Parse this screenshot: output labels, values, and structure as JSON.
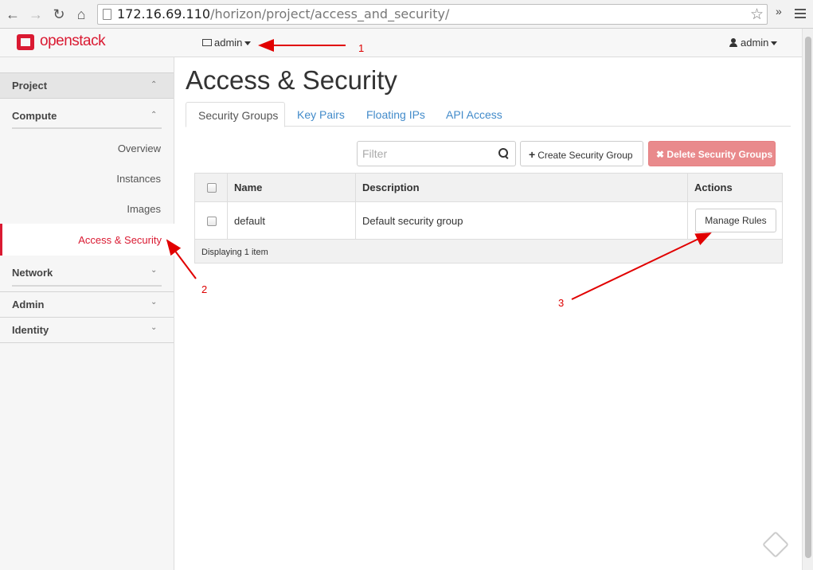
{
  "browser": {
    "url_host": "172.16.69.110",
    "url_path": "/horizon/project/access_and_security/",
    "extension_label": "»"
  },
  "header": {
    "logo_text": "openstack",
    "project_label": "admin",
    "user_label": "admin",
    "brand_color": "#da1a32"
  },
  "sidebar": {
    "project": "Project",
    "compute": "Compute",
    "items": [
      "Overview",
      "Instances",
      "Images",
      "Access & Security"
    ],
    "network": "Network",
    "admin": "Admin",
    "identity": "Identity"
  },
  "main": {
    "title": "Access & Security",
    "tabs": [
      "Security Groups",
      "Key Pairs",
      "Floating IPs",
      "API Access"
    ],
    "filter_placeholder": "Filter",
    "create_button": "Create Security Group",
    "delete_button": "Delete Security Groups",
    "table": {
      "headers": [
        "Name",
        "Description",
        "Actions"
      ],
      "rows": [
        {
          "name": "default",
          "description": "Default security group",
          "action": "Manage Rules"
        }
      ],
      "footer": "Displaying 1 item"
    }
  },
  "annotations": [
    "1",
    "2",
    "3"
  ]
}
